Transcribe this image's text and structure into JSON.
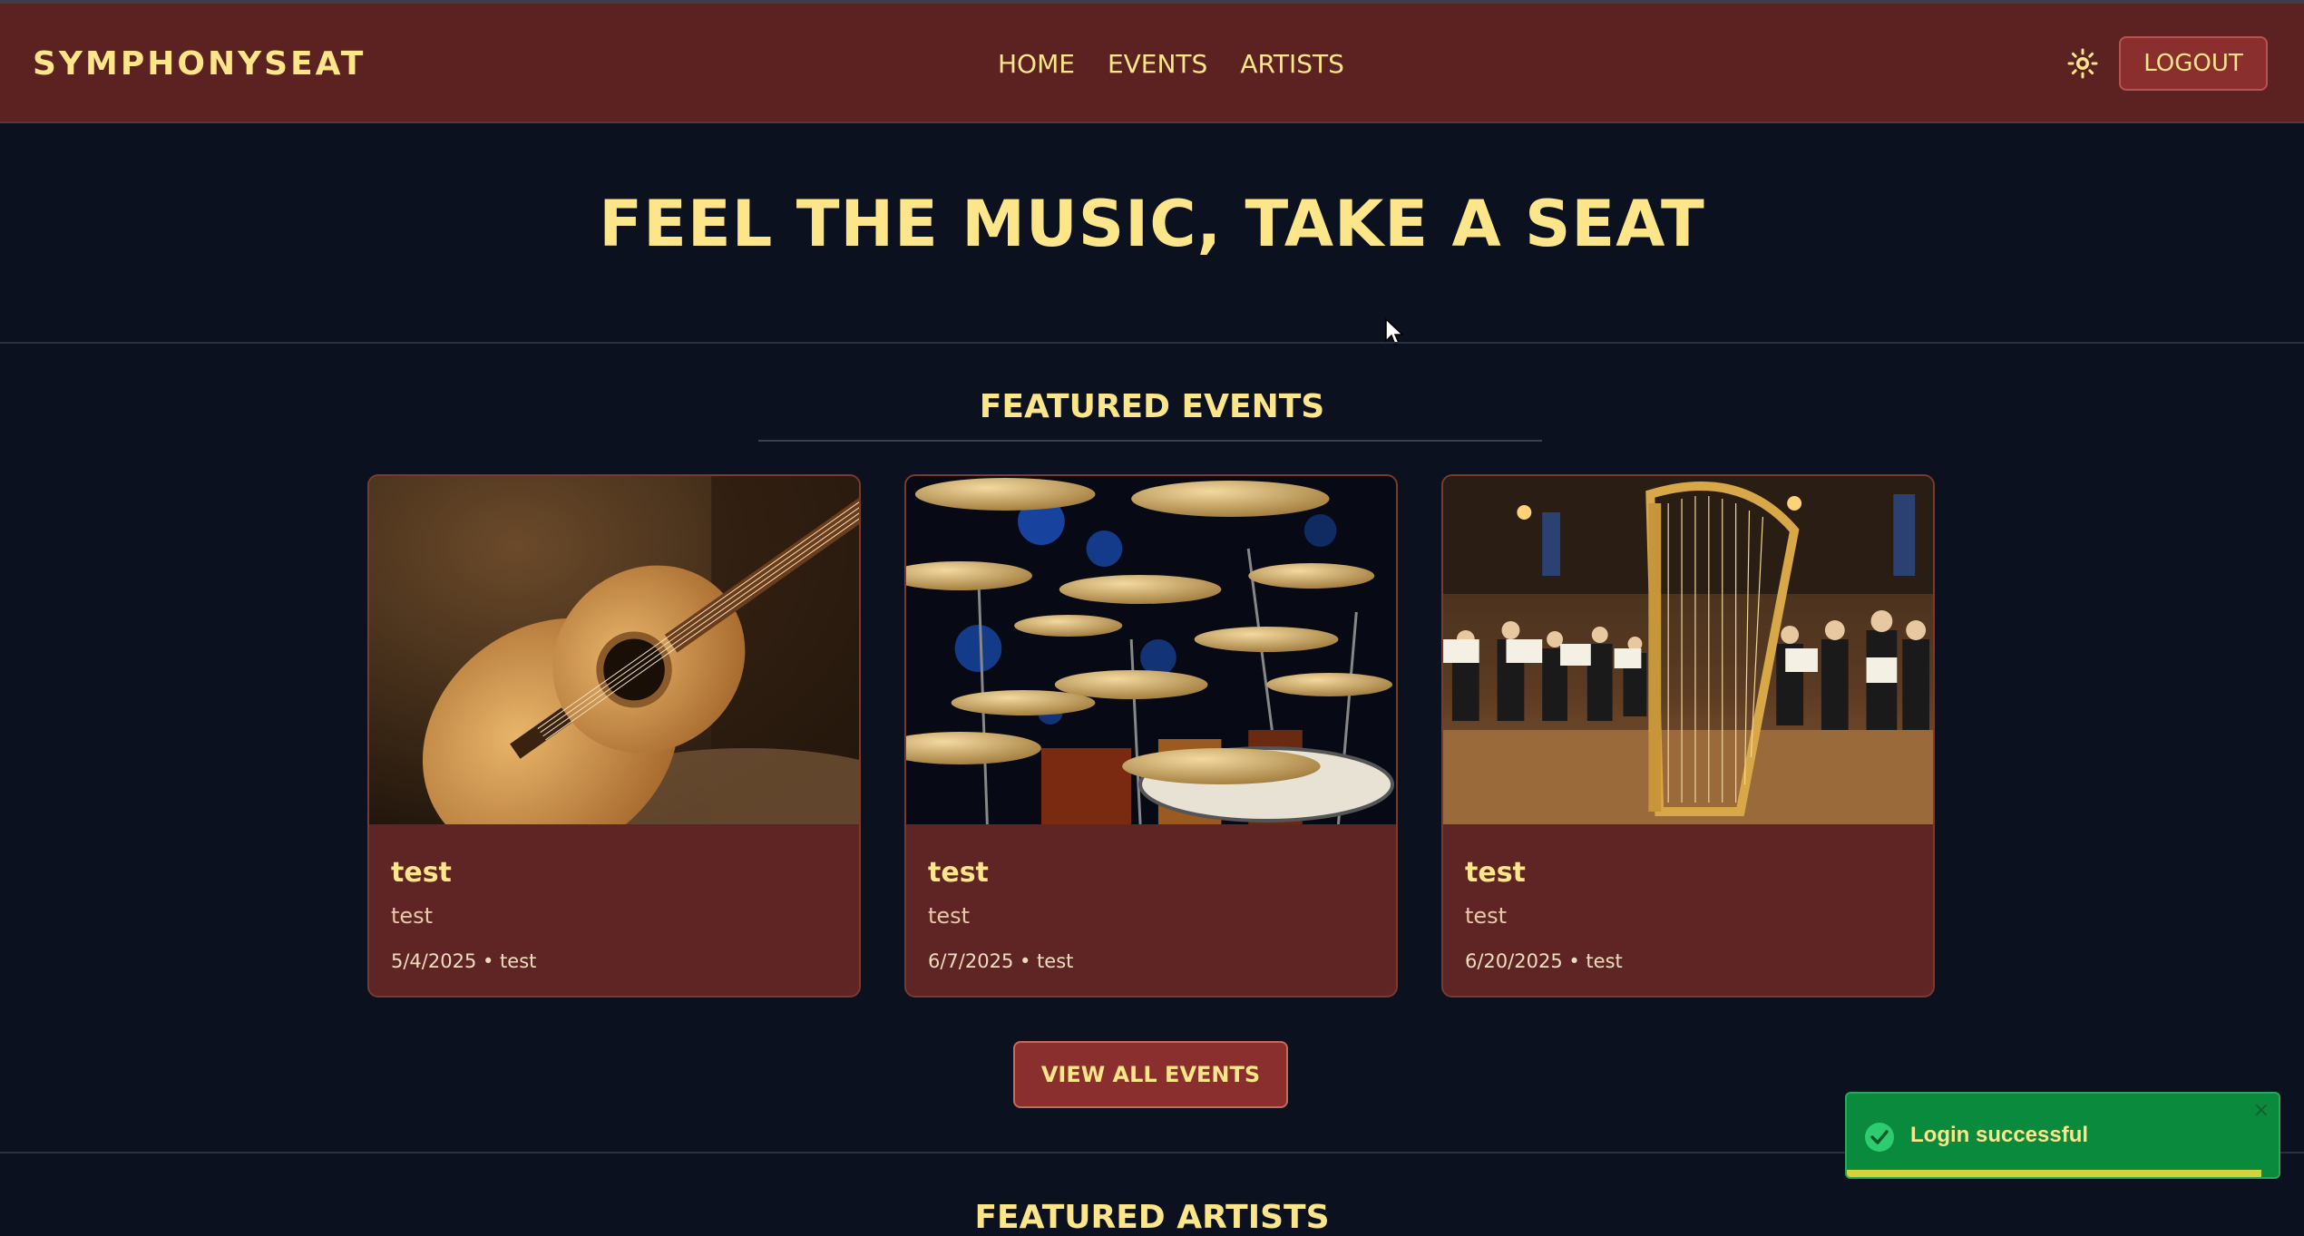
{
  "navbar": {
    "brand": "SYMPHONYSEAT",
    "links": [
      "HOME",
      "EVENTS",
      "ARTISTS"
    ],
    "theme_icon": "sun-icon",
    "logout_label": "LOGOUT"
  },
  "hero": {
    "title": "FEEL THE MUSIC, TAKE A SEAT"
  },
  "featured_events": {
    "title": "FEATURED EVENTS",
    "cards": [
      {
        "image": "guitar-image",
        "title": "test",
        "description": "test",
        "meta": "5/4/2025 • test"
      },
      {
        "image": "drum-kit-image",
        "title": "test",
        "description": "test",
        "meta": "6/7/2025 • test"
      },
      {
        "image": "orchestra-harp-image",
        "title": "test",
        "description": "test",
        "meta": "6/20/2025 • test"
      }
    ],
    "view_all_label": "VIEW ALL EVENTS"
  },
  "featured_artists": {
    "title": "FEATURED ARTISTS"
  },
  "toast": {
    "message": "Login successful",
    "close": "×",
    "icon": "check-circle-icon",
    "progress": 0.96
  },
  "colors": {
    "background": "#0c1120",
    "navbar": "#5c2121",
    "accent_text": "#fde68a",
    "button": "#8b2e2e",
    "card": "#5f2424",
    "toast": "#0a8a3c"
  }
}
